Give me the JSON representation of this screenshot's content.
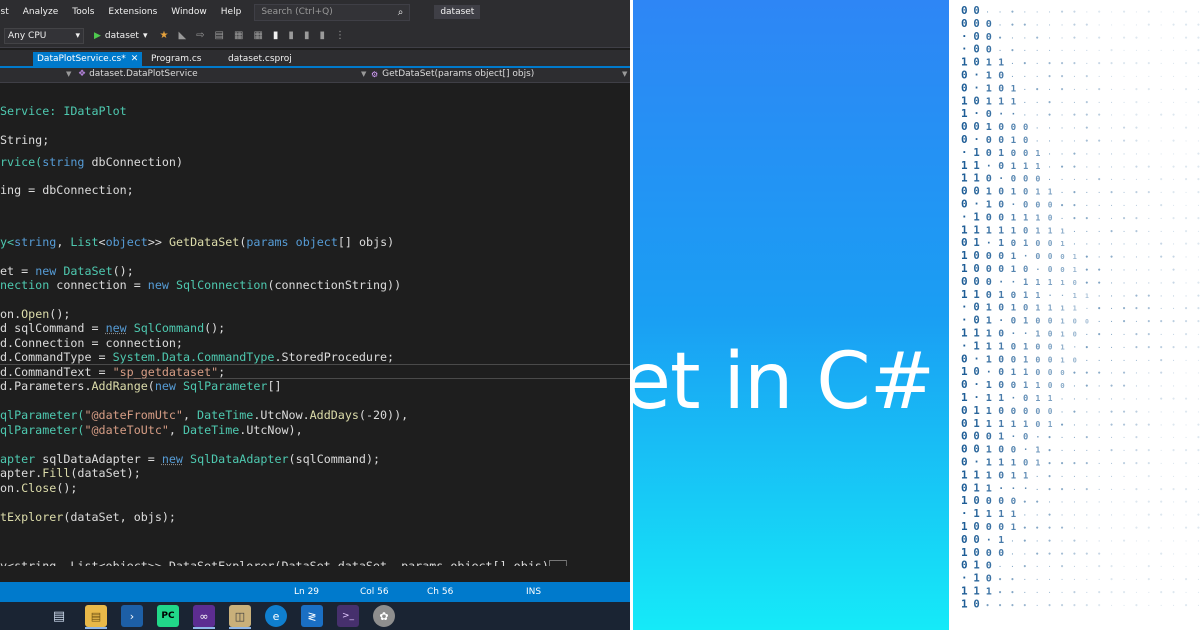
{
  "menu": {
    "items": [
      "est",
      "Analyze",
      "Tools",
      "Extensions",
      "Window",
      "Help"
    ]
  },
  "search": {
    "placeholder": "Search (Ctrl+Q)",
    "icon": "magnifier-icon"
  },
  "solution_name": "dataset",
  "toolbar": {
    "platform": "Any CPU",
    "run_target": "dataset"
  },
  "tabs": [
    {
      "label": "DataPlotService.cs*",
      "active": true
    },
    {
      "label": "Program.cs",
      "active": false
    },
    {
      "label": "dataset.csproj",
      "active": false
    }
  ],
  "navbar": {
    "class_path": "dataset.DataPlotService",
    "member": "GetDataSet(params object[] objs)"
  },
  "code_lines": [
    [
      [
        "Service: ",
        "type"
      ],
      [
        "IDataPlot",
        "type"
      ]
    ],
    [
      [
        "String;",
        "id"
      ]
    ],
    [
      [
        "rvice(",
        "type"
      ],
      [
        "string",
        "kw"
      ],
      [
        " dbConnection)",
        "id"
      ]
    ],
    [
      [
        "ing = dbConnection;",
        "id"
      ]
    ],
    [
      [
        "y<",
        "type"
      ],
      [
        "string",
        "kw"
      ],
      [
        ", ",
        "id"
      ],
      [
        "List",
        "type"
      ],
      [
        "<",
        "id"
      ],
      [
        "object",
        "kw"
      ],
      [
        ">> ",
        "id"
      ],
      [
        "GetDataSet",
        "method"
      ],
      [
        "(",
        "id"
      ],
      [
        "params",
        "kw"
      ],
      [
        " ",
        "id"
      ],
      [
        "object",
        "kw"
      ],
      [
        "[] objs)",
        "id"
      ]
    ],
    [
      [
        "et = ",
        "id"
      ],
      [
        "new",
        "kw"
      ],
      [
        " ",
        "id"
      ],
      [
        "DataSet",
        "type"
      ],
      [
        "();",
        "id"
      ]
    ],
    [
      [
        "nection ",
        "type"
      ],
      [
        "connection = ",
        "id"
      ],
      [
        "new",
        "kw"
      ],
      [
        " ",
        "id"
      ],
      [
        "SqlConnection",
        "type"
      ],
      [
        "(connectionString))",
        "id"
      ]
    ],
    [
      [
        "on.",
        "id"
      ],
      [
        "Open",
        "method"
      ],
      [
        "();",
        "id"
      ]
    ],
    [
      [
        "d sqlCommand = ",
        "id"
      ],
      [
        "new",
        "kw_warn"
      ],
      [
        " ",
        "id"
      ],
      [
        "SqlCommand",
        "type"
      ],
      [
        "();",
        "id"
      ]
    ],
    [
      [
        "d.Connection = connection;",
        "id"
      ]
    ],
    [
      [
        "d.CommandType = ",
        "id"
      ],
      [
        "System.Data.",
        "type"
      ],
      [
        "CommandType",
        "type"
      ],
      [
        ".StoredProcedure;",
        "id"
      ]
    ],
    [
      [
        "d.CommandText = ",
        "id"
      ],
      [
        "\"sp_getdataset\"",
        "str"
      ],
      [
        ";",
        "id"
      ]
    ],
    [
      [
        "d.Parameters.",
        "id"
      ],
      [
        "AddRange",
        "method"
      ],
      [
        "(",
        "id"
      ],
      [
        "new",
        "kw"
      ],
      [
        " ",
        "id"
      ],
      [
        "SqlParameter",
        "type"
      ],
      [
        "[]",
        "id"
      ]
    ],
    [
      [
        "qlParameter(",
        "type"
      ],
      [
        "\"@dateFromUtc\"",
        "str"
      ],
      [
        ", ",
        "id"
      ],
      [
        "DateTime",
        "type"
      ],
      [
        ".UtcNow.",
        "id"
      ],
      [
        "AddDays",
        "method"
      ],
      [
        "(-20)),",
        "id"
      ]
    ],
    [
      [
        "qlParameter(",
        "type"
      ],
      [
        "\"@dateToUtc\"",
        "str"
      ],
      [
        ", ",
        "id"
      ],
      [
        "DateTime",
        "type"
      ],
      [
        ".UtcNow),",
        "id"
      ]
    ],
    [
      [
        "apter ",
        "type"
      ],
      [
        "sqlDataAdapter = ",
        "id"
      ],
      [
        "new",
        "kw_warn"
      ],
      [
        " ",
        "id"
      ],
      [
        "SqlDataAdapter",
        "type"
      ],
      [
        "(sqlCommand);",
        "id"
      ]
    ],
    [
      [
        "apter.",
        "id"
      ],
      [
        "Fill",
        "method"
      ],
      [
        "(dataSet);",
        "id"
      ]
    ],
    [
      [
        "on.",
        "id"
      ],
      [
        "Close",
        "method"
      ],
      [
        "();",
        "id"
      ]
    ],
    [
      [
        "tExplorer",
        "method"
      ],
      [
        "(dataSet, objs);",
        "id"
      ]
    ],
    [
      [
        "y<string, List<object>> DataSetExplorer(DataSet dataSet, params object[] objs)",
        "id"
      ]
    ]
  ],
  "status": {
    "line": "Ln 29",
    "col": "Col 56",
    "ch": "Ch 56",
    "mode": "INS"
  },
  "taskbar_icons": [
    "task-view-icon",
    "file-explorer-icon",
    "powershell-icon",
    "pycharm-icon",
    "visual-studio-icon",
    "ssms-icon",
    "edge-icon",
    "vscode-icon",
    "terminal-icon",
    "network-tool-icon"
  ],
  "banner": {
    "title": "et in C#"
  },
  "colors": {
    "ide_bg": "#1e1e1e",
    "accent": "#007acc",
    "banner_top": "#2e86f5",
    "banner_bottom": "#15eaf8"
  }
}
